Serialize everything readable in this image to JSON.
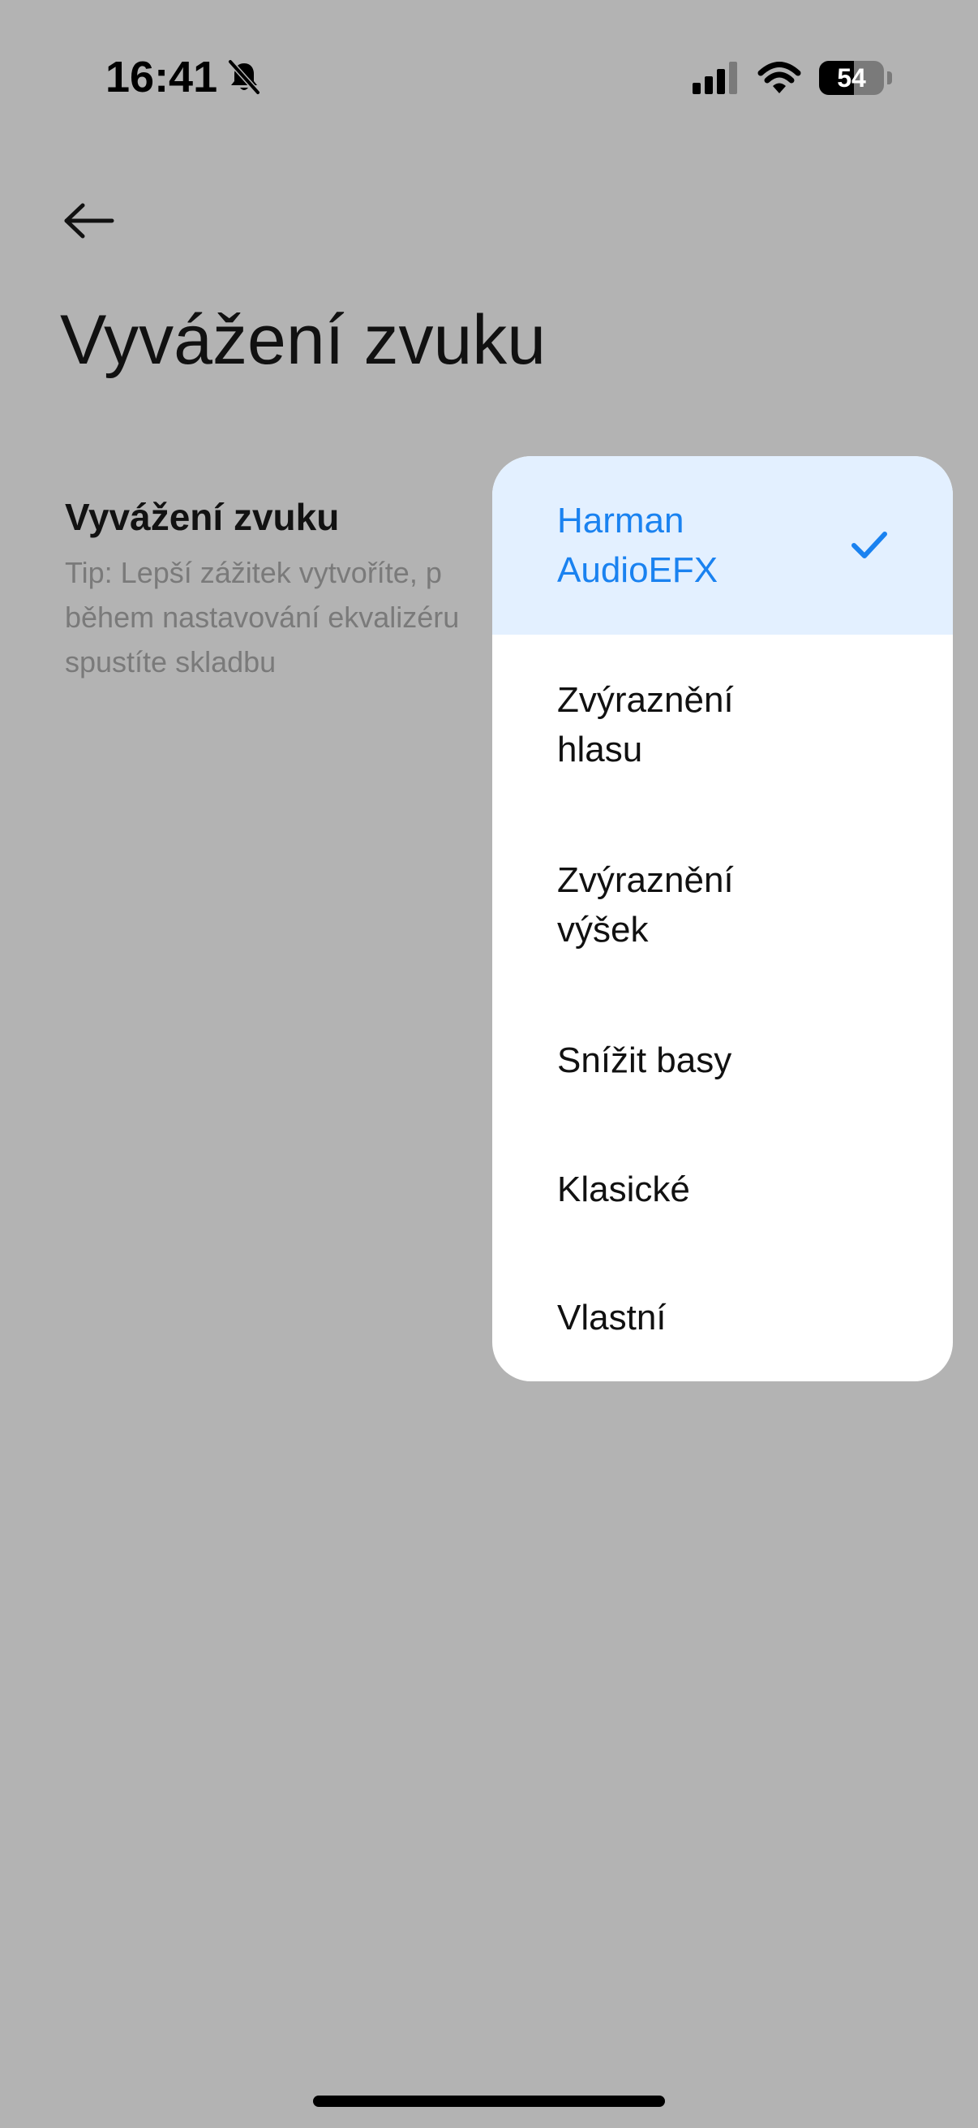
{
  "status_bar": {
    "time": "16:41",
    "mute_icon": "bell-slash-icon",
    "signal_icon": "cellular-signal-icon",
    "wifi_icon": "wifi-icon",
    "battery_level": "54",
    "battery_fraction": 0.54
  },
  "header": {
    "back_icon": "arrow-left-icon",
    "title": "Vyvážení zvuku"
  },
  "setting": {
    "title": "Vyvážení zvuku",
    "tip": "Tip: Lepší zážitek vytvoříte, p\nběhem nastavování ekvalizéru\nspustíte skladbu"
  },
  "dropdown": {
    "selected_index": 0,
    "accent_color": "#1a82f0",
    "selected_bg": "#e3f0ff",
    "options": [
      {
        "label": "Harman\nAudioEFX",
        "selected": true,
        "icon": "checkmark-icon"
      },
      {
        "label": "Zvýraznění\nhlasu",
        "selected": false
      },
      {
        "label": "Zvýraznění\nvýšek",
        "selected": false
      },
      {
        "label": "Snížit basy",
        "selected": false
      },
      {
        "label": "Klasické",
        "selected": false
      },
      {
        "label": "Vlastní",
        "selected": false
      }
    ]
  },
  "colors": {
    "scrim": "#b3b3b3",
    "menu_bg": "#ffffff",
    "text": "#111111",
    "tip_text": "#7a7a7a"
  }
}
